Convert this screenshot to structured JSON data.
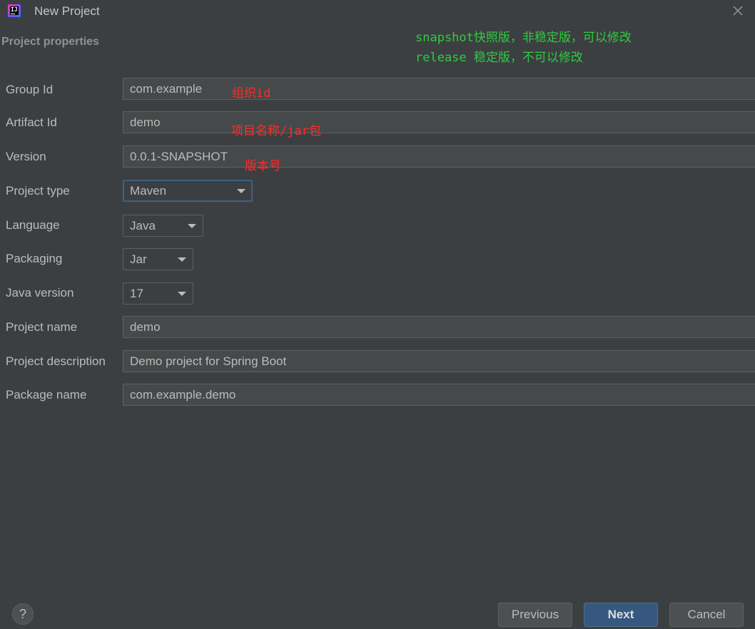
{
  "window": {
    "title": "New Project"
  },
  "section_title": "Project properties",
  "annotations": {
    "snapshot_note": "snapshot快照版，非稳定版，可以修改",
    "release_note": "release 稳定版，不可以修改",
    "group_note": "组织id",
    "artifact_note": "项目名称/jar包",
    "version_note": "版本号",
    "note_color_green": "#2ecc40",
    "note_color_red": "#ff2b2b"
  },
  "form": {
    "group_id": {
      "label": "Group Id",
      "value": "com.example"
    },
    "artifact_id": {
      "label": "Artifact Id",
      "value": "demo"
    },
    "version": {
      "label": "Version",
      "value": "0.0.1-SNAPSHOT"
    },
    "project_type": {
      "label": "Project type",
      "value": "Maven"
    },
    "language": {
      "label": "Language",
      "value": "Java"
    },
    "packaging": {
      "label": "Packaging",
      "value": "Jar"
    },
    "java_version": {
      "label": "Java version",
      "value": "17"
    },
    "project_name": {
      "label": "Project name",
      "value": "demo"
    },
    "project_description": {
      "label": "Project description",
      "value": "Demo project for Spring Boot"
    },
    "package_name": {
      "label": "Package name",
      "value": "com.example.demo"
    }
  },
  "footer": {
    "help_label": "?",
    "previous_label": "Previous",
    "next_label": "Next",
    "cancel_label": "Cancel"
  },
  "icons": {
    "app": "intellij-idea-icon",
    "close": "close-icon",
    "dropdown": "chevron-down-icon",
    "help": "help-icon"
  },
  "colors": {
    "background": "#3c3f41",
    "field_background": "#45494a",
    "primary_button": "#365880",
    "focus_border": "#3d6185"
  }
}
